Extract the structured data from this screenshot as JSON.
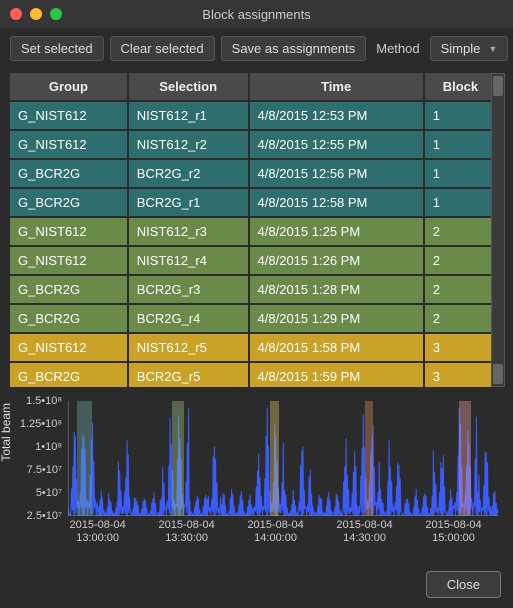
{
  "window": {
    "title": "Block assignments"
  },
  "toolbar": {
    "set_selected": "Set selected",
    "clear_selected": "Clear selected",
    "save_assignments": "Save as assignments",
    "method_label": "Method",
    "method_value": "Simple"
  },
  "table": {
    "columns": [
      "Group",
      "Selection",
      "Time",
      "Block"
    ],
    "rows": [
      {
        "group": "G_NIST612",
        "selection": "NIST612_r1",
        "time": "4/8/2015 12:53 PM",
        "block": "1",
        "cls": "c1"
      },
      {
        "group": "G_NIST612",
        "selection": "NIST612_r2",
        "time": "4/8/2015 12:55 PM",
        "block": "1",
        "cls": "c1"
      },
      {
        "group": "G_BCR2G",
        "selection": "BCR2G_r2",
        "time": "4/8/2015 12:56 PM",
        "block": "1",
        "cls": "c1"
      },
      {
        "group": "G_BCR2G",
        "selection": "BCR2G_r1",
        "time": "4/8/2015 12:58 PM",
        "block": "1",
        "cls": "c1"
      },
      {
        "group": "G_NIST612",
        "selection": "NIST612_r3",
        "time": "4/8/2015 1:25 PM",
        "block": "2",
        "cls": "c2"
      },
      {
        "group": "G_NIST612",
        "selection": "NIST612_r4",
        "time": "4/8/2015 1:26 PM",
        "block": "2",
        "cls": "c2"
      },
      {
        "group": "G_BCR2G",
        "selection": "BCR2G_r3",
        "time": "4/8/2015 1:28 PM",
        "block": "2",
        "cls": "c2"
      },
      {
        "group": "G_BCR2G",
        "selection": "BCR2G_r4",
        "time": "4/8/2015 1:29 PM",
        "block": "2",
        "cls": "c2"
      },
      {
        "group": "G_NIST612",
        "selection": "NIST612_r5",
        "time": "4/8/2015 1:58 PM",
        "block": "3",
        "cls": "c3"
      },
      {
        "group": "G_BCR2G",
        "selection": "BCR2G_r5",
        "time": "4/8/2015 1:59 PM",
        "block": "3",
        "cls": "c3"
      }
    ]
  },
  "chart_data": {
    "type": "line",
    "title": "",
    "xlabel": "",
    "ylabel": "Total beam",
    "ylim": [
      25000000.0,
      150000000.0
    ],
    "xlim": [
      "2015-08-04 12:50:00",
      "2015-08-04 15:15:00"
    ],
    "yticks": [
      25000000.0,
      50000000.0,
      75000000.0,
      100000000.0,
      125000000.0,
      150000000.0
    ],
    "ytick_labels": [
      "2.5•10⁷",
      "5•10⁷",
      "7.5•10⁷",
      "1•10⁸",
      "1.25•10⁸",
      "1.5•10⁸"
    ],
    "xticks": [
      "2015-08-04 13:00:00",
      "2015-08-04 13:30:00",
      "2015-08-04 14:00:00",
      "2015-08-04 14:30:00",
      "2015-08-04 15:00:00"
    ],
    "xtick_labels": [
      "2015-08-04\n13:00:00",
      "2015-08-04\n13:30:00",
      "2015-08-04\n14:00:00",
      "2015-08-04\n14:30:00",
      "2015-08-04\n15:00:00"
    ],
    "bands": [
      {
        "start": "2015-08-04 12:53:00",
        "end": "2015-08-04 12:58:00",
        "color": "#6fa8a8"
      },
      {
        "start": "2015-08-04 13:25:00",
        "end": "2015-08-04 13:29:00",
        "color": "#9bc080"
      },
      {
        "start": "2015-08-04 13:58:00",
        "end": "2015-08-04 14:01:00",
        "color": "#d8c05a"
      },
      {
        "start": "2015-08-04 14:30:00",
        "end": "2015-08-04 14:33:00",
        "color": "#d88a5a"
      },
      {
        "start": "2015-08-04 15:02:00",
        "end": "2015-08-04 15:06:00",
        "color": "#e89aa0"
      }
    ],
    "series": [
      {
        "name": "Total beam",
        "baseline": 24000000.0,
        "peak": 150000000.0,
        "note": "Dense spiky signal; values oscillate rapidly between ~2.4e7 baseline and peaks up to ~1.5e8 across the full time range, with denser high-amplitude bursts roughly every 30 min coinciding with the shaded bands."
      }
    ]
  },
  "footer": {
    "close": "Close"
  }
}
